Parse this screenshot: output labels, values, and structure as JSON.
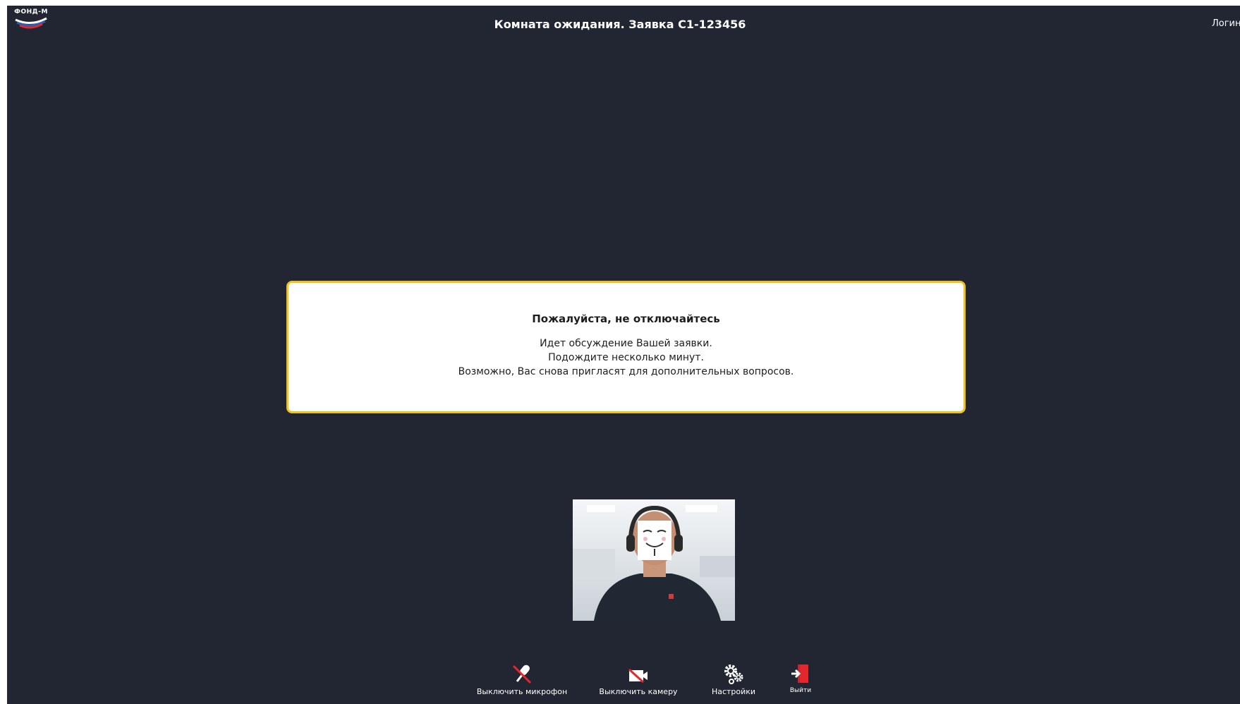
{
  "header": {
    "logo_text": "ФОНД-М",
    "title": "Комната ожидания. Заявка С1-123456",
    "login_label": "Логин"
  },
  "notice": {
    "title": "Пожалуйста, не отключайтесь",
    "lines": [
      "Идет обсуждение Вашей заявки.",
      "Подождите несколько минут.",
      "Возможно, Вас снова пригласят для дополнительных вопросов."
    ],
    "border_color": "#f2c21b"
  },
  "toolbar": {
    "mic_label": "Выключить микрофон",
    "camera_label": "Выключить камеру",
    "settings_label": "Настройки",
    "exit_label": "Выйти"
  },
  "icons": {
    "mic": "mic-off-icon",
    "camera": "camera-off-icon",
    "settings": "gears-icon",
    "exit": "exit-door-icon"
  },
  "colors": {
    "background": "#212632",
    "accent_red": "#e4262d",
    "accent_yellow": "#f2c21b"
  }
}
